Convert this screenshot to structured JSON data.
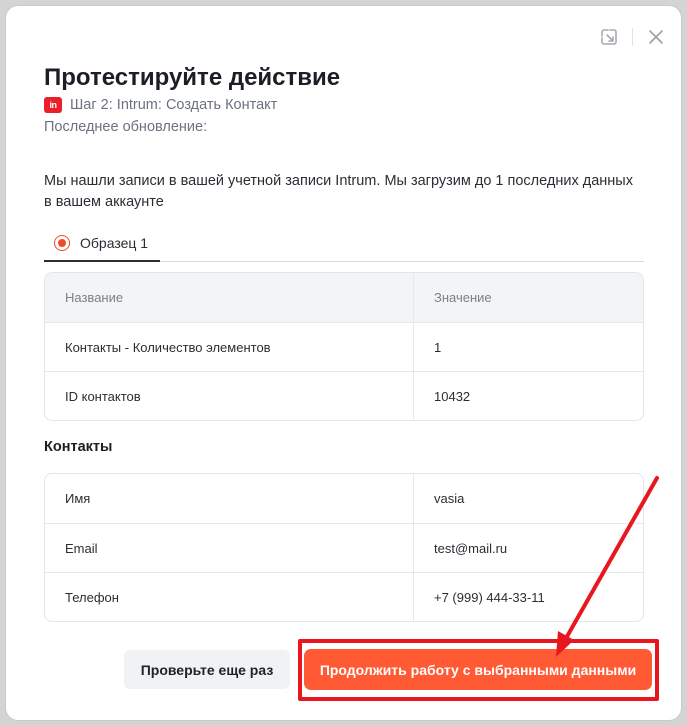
{
  "header": {
    "title": "Протестируйте действие",
    "step": "Шаг 2: Intrum: Создать Контакт",
    "app_logo_text": "in",
    "last_updated": "Последнее обновление:"
  },
  "description": "Мы нашли записи в вашей учетной записи Intrum. Мы загрузим до 1 последних данных в вашем аккаунте",
  "tabs": [
    {
      "label": "Образец 1",
      "selected": true
    }
  ],
  "summary_table": {
    "headers": [
      "Название",
      "Значение"
    ],
    "rows": [
      [
        "Контакты - Количество элементов",
        "1"
      ],
      [
        "ID контактов",
        "10432"
      ]
    ]
  },
  "contacts_section": {
    "title": "Контакты",
    "rows": [
      [
        "Имя",
        "vasia"
      ],
      [
        "Email",
        "test@mail.ru"
      ],
      [
        "Телефон",
        "+7 (999) 444-33-11"
      ]
    ]
  },
  "buttons": {
    "retry": "Проверьте еще раз",
    "continue": "Продолжить работу с выбранными данными"
  },
  "icons": {
    "expand": "expand-icon",
    "close": "close-icon"
  },
  "colors": {
    "accent": "#ff5a33",
    "annotation": "#e8171f"
  }
}
